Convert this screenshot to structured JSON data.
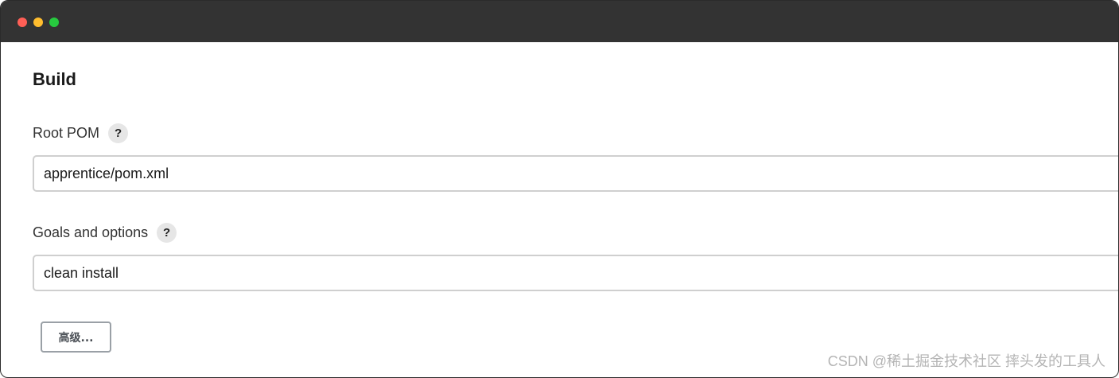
{
  "section": {
    "title": "Build"
  },
  "fields": [
    {
      "label": "Root POM",
      "help": "?",
      "value": "apprentice/pom.xml"
    },
    {
      "label": "Goals and options",
      "help": "?",
      "value": "clean install"
    }
  ],
  "buttons": {
    "advanced_label": "高级..."
  },
  "watermark": {
    "text": "CSDN @稀土掘金技术社区 摔头发的工具人"
  },
  "colors": {
    "titlebar": "#333333",
    "close_dot": "#ff5f56",
    "minimize_dot": "#ffbd2e",
    "maximize_dot": "#27c93f",
    "input_border": "#cfcfcf",
    "button_border": "#9aa0a6"
  }
}
